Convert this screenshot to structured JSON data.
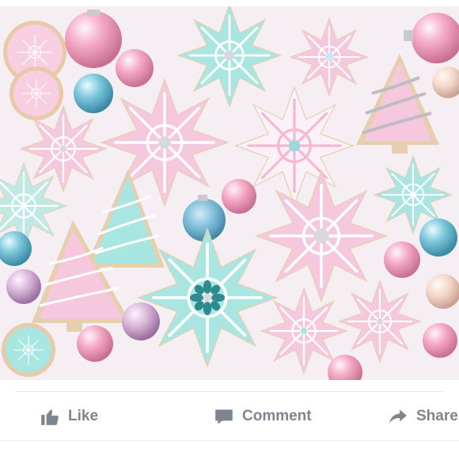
{
  "post": {
    "image_alt": "Pastel Christmas sugar cookies with ornaments",
    "actions": {
      "like_label": "Like",
      "comment_label": "Comment",
      "share_label": "Share"
    }
  },
  "colors": {
    "action_text": "#7f858f",
    "divider": "#e3e5e8",
    "pink_icing": "#f6c8de",
    "mint_icing": "#a9e6e1",
    "white_icing": "#fbf1f6"
  },
  "icons": [
    "thumbs-up-icon",
    "comment-bubble-icon",
    "share-arrow-icon"
  ]
}
